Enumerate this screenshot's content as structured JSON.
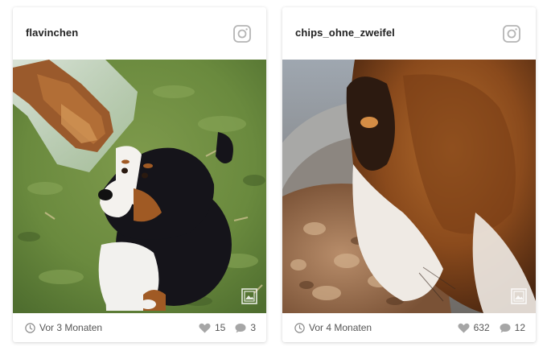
{
  "posts": [
    {
      "username": "flavinchen",
      "time": "Vor 3 Monaten",
      "likes": "15",
      "comments": "3",
      "photo_icon": "gallery-icon",
      "network_icon": "instagram-icon"
    },
    {
      "username": "chips_ohne_zweifel",
      "time": "Vor 4 Monaten",
      "likes": "632",
      "comments": "12",
      "photo_icon": "gallery-icon",
      "network_icon": "instagram-icon"
    }
  ],
  "colors": {
    "icon_gray": "#b5b5b5",
    "meta_gray": "#8a8a8a",
    "username": "#222222"
  }
}
